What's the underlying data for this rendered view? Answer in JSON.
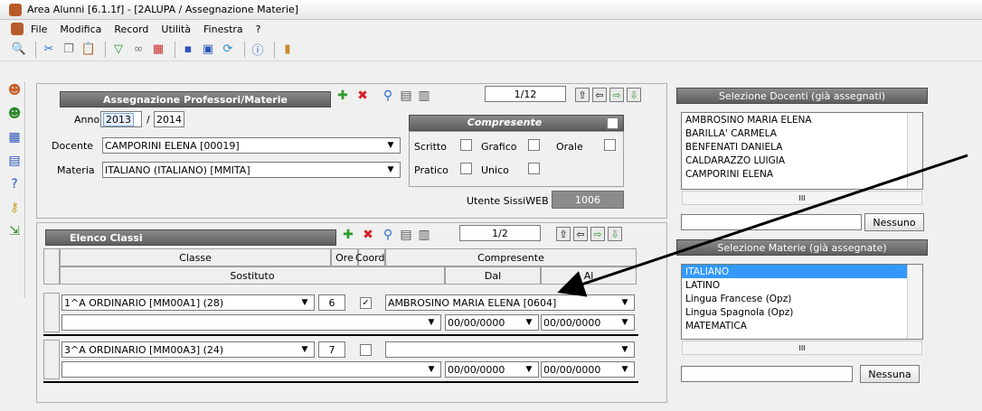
{
  "window": {
    "title": "Area Alunni [6.1.1f] - [2ALUPA / Assegnazione Materie]"
  },
  "menu": [
    "File",
    "Modifica",
    "Record",
    "Utilità",
    "Finestra",
    "?"
  ],
  "assign_panel": {
    "title": "Assegnazione Professori/Materie",
    "counter": "1/12",
    "anno_label": "Anno",
    "anno_from": "2013",
    "anno_sep": "/",
    "anno_to": "2014",
    "docente_label": "Docente",
    "docente_value": "CAMPORINI ELENA [00019]",
    "materia_label": "Materia",
    "materia_value": "ITALIANO (ITALIANO) [MMITA]",
    "compresente_label": "Compresente",
    "scritto": "Scritto",
    "grafico": "Grafico",
    "orale": "Orale",
    "pratico": "Pratico",
    "unico": "Unico",
    "utente_label": "Utente SissiWEB",
    "utente_value": "1006"
  },
  "classi_panel": {
    "title": "Elenco Classi",
    "counter": "1/2",
    "col_classe": "Classe",
    "col_ore": "Ore",
    "col_coord": "Coord.",
    "col_compresente": "Compresente",
    "col_sostituto": "Sostituto",
    "col_dal": "Dal",
    "col_al": "Al",
    "rows": [
      {
        "classe": "1^A ORDINARIO [MM00A1] (28)",
        "ore": "6",
        "coord": true,
        "compresente": "AMBROSINO MARIA ELENA [0604]",
        "dal": "00/00/0000",
        "al": "00/00/0000"
      },
      {
        "classe": "3^A ORDINARIO [MM00A3] (24)",
        "ore": "7",
        "coord": false,
        "compresente": "",
        "dal": "00/00/0000",
        "al": "00/00/0000"
      }
    ]
  },
  "docenti_panel": {
    "title": "Selezione Docenti (già assegnati)",
    "items": [
      "AMBROSINO MARIA ELENA",
      "BARILLA' CARMELA",
      "BENFENATI DANIELA",
      "CALDARAZZO LUIGIA",
      "CAMPORINI  ELENA"
    ],
    "button": "Nessuno",
    "scroll_mid": "III"
  },
  "materie_panel": {
    "title": "Selezione Materie (già assegnate)",
    "items": [
      "ITALIANO",
      "LATINO",
      "Lingua Francese (Opz)",
      "Lingua Spagnola (Opz)",
      "MATEMATICA"
    ],
    "button": "Nessuna",
    "scroll_mid": "III"
  },
  "colors": {
    "header_bg": "#6e6e6e",
    "selection": "#3399ff"
  }
}
